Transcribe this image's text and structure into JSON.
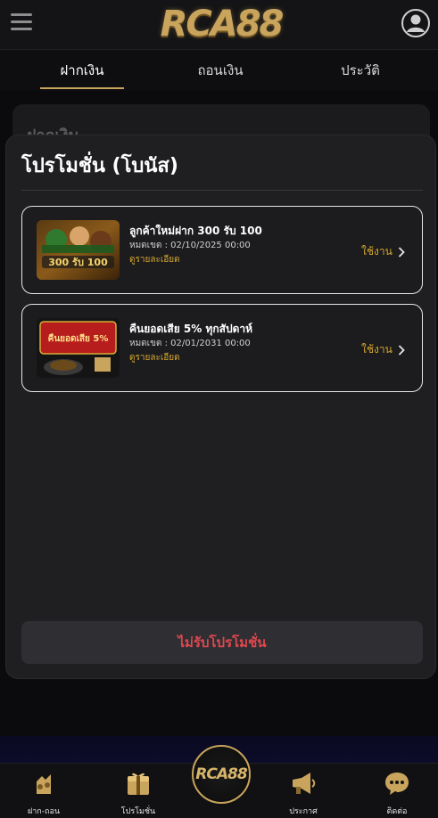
{
  "header": {
    "logo_text": "RCA88",
    "menu_icon": "hamburger-icon",
    "user_icon": "user-circle-icon"
  },
  "tabs": [
    {
      "label": "ฝากเงิน",
      "active": true
    },
    {
      "label": "ถอนเงิน",
      "active": false
    },
    {
      "label": "ประวัติ",
      "active": false
    }
  ],
  "background_card": {
    "title": "ฝากเงิน"
  },
  "modal": {
    "title": "โปรโมชั่น (โบนัส)",
    "promotions": [
      {
        "title": "ลูกค้าใหม่ฝาก 300 รับ 100",
        "expire": "หมดเขต : 02/10/2025 00:00",
        "detail_link": "ดูรายละเอียด",
        "use_label": "ใช้งาน",
        "thumb_text": "300 รับ 100"
      },
      {
        "title": "คืนยอดเสีย 5% ทุกสัปดาห์",
        "expire": "หมดเขต : 02/01/2031 00:00",
        "detail_link": "ดูรายละเอียด",
        "use_label": "ใช้งาน",
        "thumb_text": "คืนยอดเสีย 5%"
      }
    ],
    "decline_label": "ไม่รับโปรโมชั่น"
  },
  "bottom_nav": {
    "items": [
      {
        "label": "ฝาก-ถอน",
        "icon": "deposit-withdraw-icon"
      },
      {
        "label": "โปรโมชั่น",
        "icon": "promotion-icon"
      },
      {
        "label": "ประกาศ",
        "icon": "announcement-icon"
      },
      {
        "label": "ติดต่อ",
        "icon": "chat-icon"
      }
    ],
    "center_logo_text": "RCA88"
  },
  "colors": {
    "gold": "#c9a45c",
    "link_gold": "#d6a82d",
    "decline_red": "#e0474f"
  }
}
